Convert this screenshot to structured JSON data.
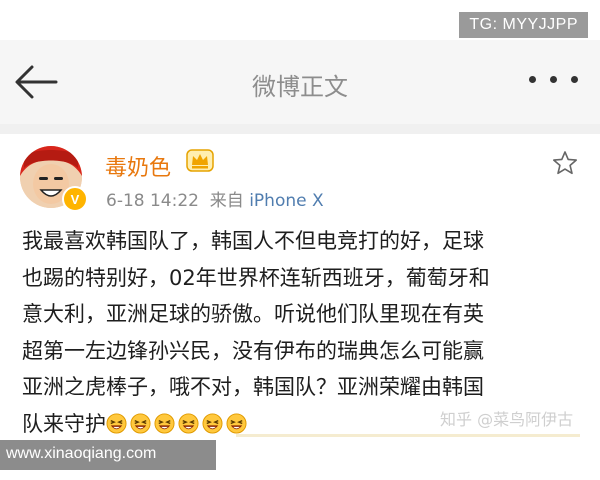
{
  "watermark": {
    "tg": "TG: MYYJJPP",
    "site": "www.xinaoqiang.com",
    "zhihu": "知乎 @菜鸟阿伊古"
  },
  "header": {
    "title": "微博正文",
    "back_icon": "arrow-left-icon",
    "more_icon": "more-dots-icon"
  },
  "post": {
    "author": "毒奶色",
    "verified_badge": "V",
    "time": "6-18 14:22",
    "source_prefix": "来自",
    "source": "iPhone X",
    "lines": [
      "我最喜欢韩国队了，韩国人不但电竞打的好，足球",
      "也踢的特别好，02年世界杯连斩西班牙，葡萄牙和",
      "意大利，亚洲足球的骄傲。听说他们队里现在有英",
      "超第一左边锋孙兴民，没有伊布的瑞典怎么可能赢",
      "亚洲之虎棒子，哦不对，韩国队？亚洲荣耀由韩国",
      "队来守护"
    ],
    "emoji_icon": "laughing-emoji-icon",
    "emoji_count": 6
  },
  "colors": {
    "username": "#e8780e",
    "source_link": "#507daf",
    "badge": "#ffb400"
  }
}
